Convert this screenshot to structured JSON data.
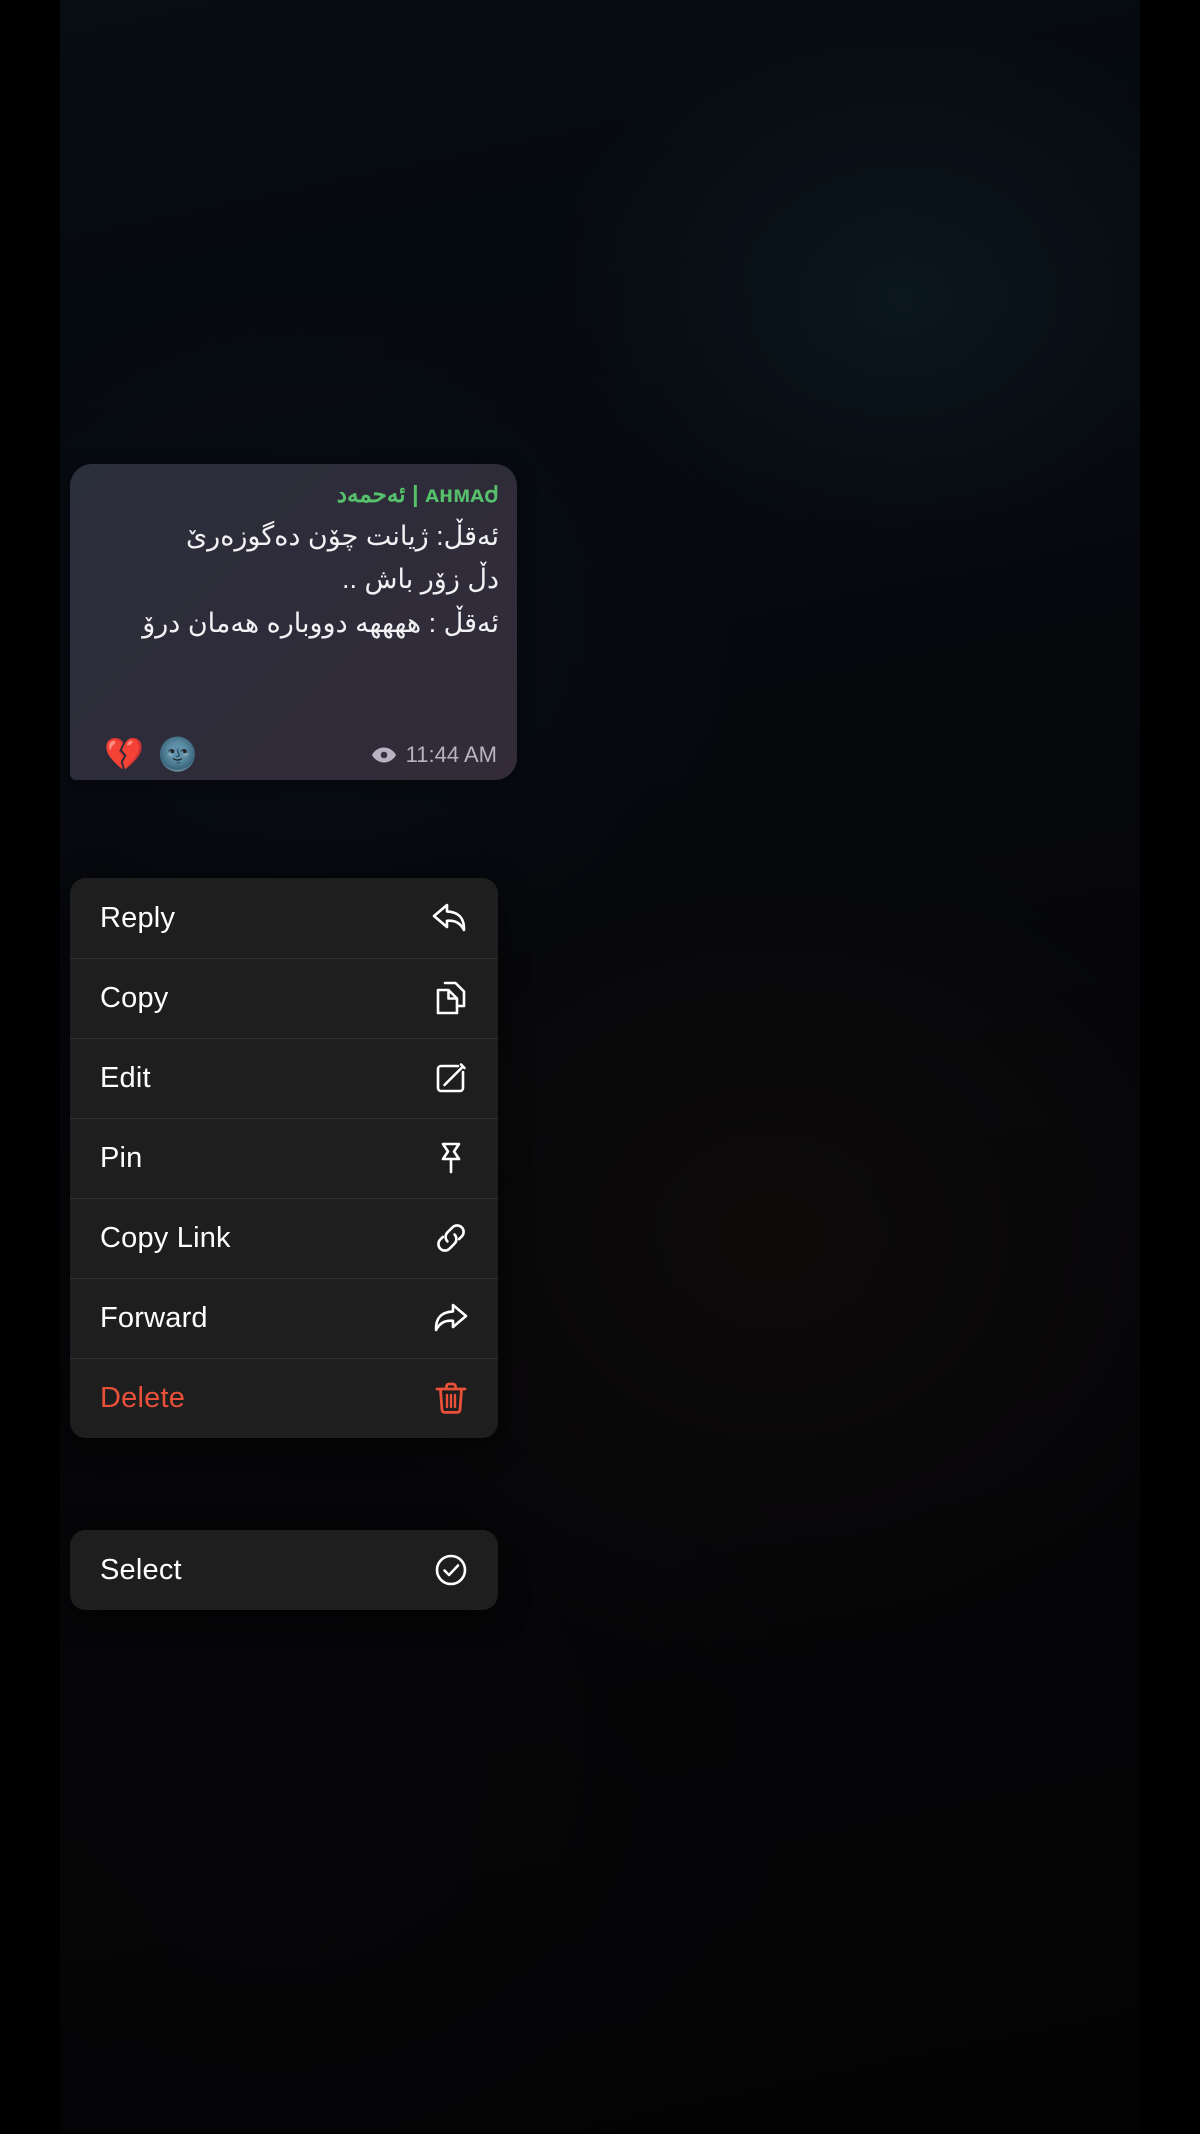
{
  "app": {
    "name": "telegram-chat",
    "theme": "dark"
  },
  "colors": {
    "menu_background": "#1e1e1e",
    "menu_separator": "#2f2f2f",
    "menu_label": "#ffffff",
    "danger": "#e8503a",
    "sender_name": "#56c16a",
    "bubble_text": "#f2f2f4",
    "timestamp_text": "#b9b2c2",
    "screen_background": "#000000"
  },
  "message": {
    "sender_name": "ᴀʜᴍᴀᲫ | ئەحمەد",
    "lines": [
      "ئەقڵ: ژیانت چۆن دەگوزەرێ",
      "دڵ زۆر باش ..",
      "ئەقڵ : ههههه دووباره هەمان درۆ"
    ],
    "reactions": [
      {
        "name": "broken-heart",
        "glyph": "💔"
      },
      {
        "name": "new-moon-face",
        "glyph": "🌚"
      }
    ],
    "view_icon": "eye-icon",
    "timestamp": "11:44 AM"
  },
  "context_menu": {
    "groups": [
      {
        "name": "primary-actions",
        "items": [
          {
            "label": "Reply",
            "icon": "reply-icon",
            "danger": false
          },
          {
            "label": "Copy",
            "icon": "copy-icon",
            "danger": false
          },
          {
            "label": "Edit",
            "icon": "edit-icon",
            "danger": false
          },
          {
            "label": "Pin",
            "icon": "pin-icon",
            "danger": false
          },
          {
            "label": "Copy Link",
            "icon": "link-icon",
            "danger": false
          },
          {
            "label": "Forward",
            "icon": "forward-icon",
            "danger": false
          },
          {
            "label": "Delete",
            "icon": "trash-icon",
            "danger": true
          }
        ]
      },
      {
        "name": "selection-actions",
        "items": [
          {
            "label": "Select",
            "icon": "check-circle-icon",
            "danger": false
          }
        ]
      }
    ]
  }
}
